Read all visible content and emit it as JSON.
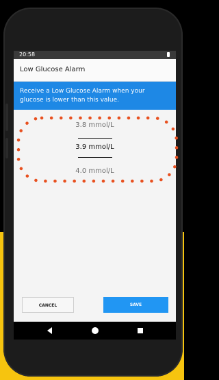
{
  "status_bar": {
    "time": "20:58"
  },
  "app_bar": {
    "title": "Low Glucose Alarm"
  },
  "banner": {
    "text": "Receive a Low Glucose Alarm when your glucose is lower than this value."
  },
  "picker": {
    "previous_value": "3.8 mmol/L",
    "selected_value": "3.9 mmol/L",
    "next_value": "4.0 mmol/L"
  },
  "buttons": {
    "cancel": "CANCEL",
    "save": "SAVE"
  },
  "nav": {
    "back_icon": "back-triangle",
    "home_icon": "home-circle",
    "recents_icon": "recents-square"
  },
  "colors": {
    "accent": "#2196f3",
    "banner": "#1e88e5",
    "highlight_dots": "#e8501f",
    "background_accent": "#f6c40f"
  }
}
